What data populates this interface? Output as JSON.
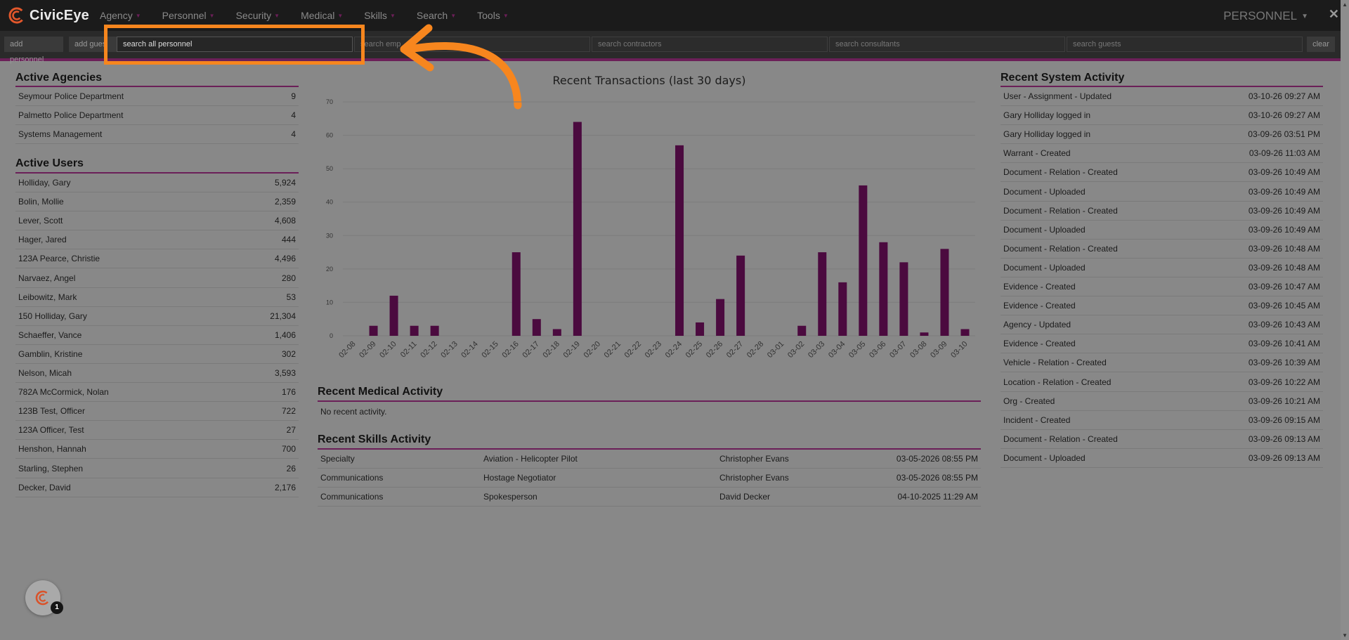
{
  "app": {
    "name": "CivicEye",
    "nav": [
      {
        "label": "Agency"
      },
      {
        "label": "Personnel"
      },
      {
        "label": "Security"
      },
      {
        "label": "Medical"
      },
      {
        "label": "Skills"
      },
      {
        "label": "Search"
      },
      {
        "label": "Tools"
      }
    ],
    "section_title": "PERSONNEL",
    "close": "✕"
  },
  "searchbar": {
    "add_personnel": "add personnel",
    "add_guest": "add gues",
    "search_all": "search all personnel",
    "search_employees": "search emp",
    "search_contractors": "search contractors",
    "search_consultants": "search consultants",
    "search_guests": "search guests",
    "clear": "clear"
  },
  "active_agencies": {
    "title": "Active Agencies",
    "rows": [
      {
        "name": "Seymour Police Department",
        "count": "9"
      },
      {
        "name": "Palmetto Police Department",
        "count": "4"
      },
      {
        "name": "Systems Management",
        "count": "4"
      }
    ]
  },
  "active_users": {
    "title": "Active Users",
    "rows": [
      {
        "name": "Holliday, Gary",
        "count": "5,924"
      },
      {
        "name": "Bolin, Mollie",
        "count": "2,359"
      },
      {
        "name": "Lever, Scott",
        "count": "4,608"
      },
      {
        "name": "Hager, Jared",
        "count": "444"
      },
      {
        "name": "123A Pearce, Christie",
        "count": "4,496"
      },
      {
        "name": "Narvaez, Angel",
        "count": "280"
      },
      {
        "name": "Leibowitz, Mark",
        "count": "53"
      },
      {
        "name": "150 Holliday, Gary",
        "count": "21,304"
      },
      {
        "name": "Schaeffer, Vance",
        "count": "1,406"
      },
      {
        "name": "Gamblin, Kristine",
        "count": "302"
      },
      {
        "name": "Nelson, Micah",
        "count": "3,593"
      },
      {
        "name": "782A McCormick, Nolan",
        "count": "176"
      },
      {
        "name": "123B Test, Officer",
        "count": "722"
      },
      {
        "name": "123A Officer, Test",
        "count": "27"
      },
      {
        "name": "Henshon, Hannah",
        "count": "700"
      },
      {
        "name": "Starling, Stephen",
        "count": "26"
      },
      {
        "name": "Decker, David",
        "count": "2,176"
      }
    ]
  },
  "chart_data": {
    "type": "bar",
    "title": "Recent Transactions (last 30 days)",
    "categories": [
      "02-08",
      "02-09",
      "02-10",
      "02-11",
      "02-12",
      "02-13",
      "02-14",
      "02-15",
      "02-16",
      "02-17",
      "02-18",
      "02-19",
      "02-20",
      "02-21",
      "02-22",
      "02-23",
      "02-24",
      "02-25",
      "02-26",
      "02-27",
      "02-28",
      "03-01",
      "03-02",
      "03-03",
      "03-04",
      "03-05",
      "03-06",
      "03-07",
      "03-08",
      "03-09",
      "03-10"
    ],
    "values": [
      0,
      3,
      12,
      3,
      3,
      0,
      0,
      0,
      25,
      5,
      2,
      64,
      0,
      0,
      0,
      0,
      57,
      4,
      11,
      24,
      0,
      0,
      3,
      25,
      16,
      45,
      28,
      22,
      1,
      26,
      2
    ],
    "yticks": [
      "0",
      "10",
      "20",
      "30",
      "40",
      "50",
      "60",
      "70"
    ],
    "ylim": [
      0,
      70
    ],
    "grid": true,
    "bar_color": "#4b0a3f"
  },
  "recent_medical": {
    "title": "Recent Medical Activity",
    "empty_text": "No recent activity."
  },
  "recent_skills": {
    "title": "Recent Skills Activity",
    "rows": [
      {
        "category": "Specialty",
        "skill": "Aviation - Helicopter Pilot",
        "person": "Christopher Evans",
        "date": "03-05-2026 08:55 PM"
      },
      {
        "category": "Communications",
        "skill": "Hostage Negotiator",
        "person": "Christopher Evans",
        "date": "03-05-2026 08:55 PM"
      },
      {
        "category": "Communications",
        "skill": "Spokesperson",
        "person": "David Decker",
        "date": "04-10-2025 11:29 AM"
      }
    ]
  },
  "recent_system": {
    "title": "Recent System Activity",
    "rows": [
      {
        "event": "User - Assignment - Updated",
        "time": "03-10-26 09:27 AM"
      },
      {
        "event": "Gary Holliday logged in",
        "time": "03-10-26 09:27 AM"
      },
      {
        "event": "Gary Holliday logged in",
        "time": "03-09-26 03:51 PM"
      },
      {
        "event": "Warrant - Created",
        "time": "03-09-26 11:03 AM"
      },
      {
        "event": "Document - Relation - Created",
        "time": "03-09-26 10:49 AM"
      },
      {
        "event": "Document - Uploaded",
        "time": "03-09-26 10:49 AM"
      },
      {
        "event": "Document - Relation - Created",
        "time": "03-09-26 10:49 AM"
      },
      {
        "event": "Document - Uploaded",
        "time": "03-09-26 10:49 AM"
      },
      {
        "event": "Document - Relation - Created",
        "time": "03-09-26 10:48 AM"
      },
      {
        "event": "Document - Uploaded",
        "time": "03-09-26 10:48 AM"
      },
      {
        "event": "Evidence - Created",
        "time": "03-09-26 10:47 AM"
      },
      {
        "event": "Evidence - Created",
        "time": "03-09-26 10:45 AM"
      },
      {
        "event": "Agency - Updated",
        "time": "03-09-26 10:43 AM"
      },
      {
        "event": "Evidence - Created",
        "time": "03-09-26 10:41 AM"
      },
      {
        "event": "Vehicle - Relation - Created",
        "time": "03-09-26 10:39 AM"
      },
      {
        "event": "Location - Relation - Created",
        "time": "03-09-26 10:22 AM"
      },
      {
        "event": "Org - Created",
        "time": "03-09-26 10:21 AM"
      },
      {
        "event": "Incident - Created",
        "time": "03-09-26 09:15 AM"
      },
      {
        "event": "Document - Relation - Created",
        "time": "03-09-26 09:13 AM"
      },
      {
        "event": "Document - Uploaded",
        "time": "03-09-26 09:13 AM"
      }
    ]
  },
  "helper": {
    "badge": "1"
  },
  "colors": {
    "accent": "#6b1f58",
    "highlight": "#f7861e",
    "background": "#888888",
    "topbar": "#1b1b1b"
  }
}
